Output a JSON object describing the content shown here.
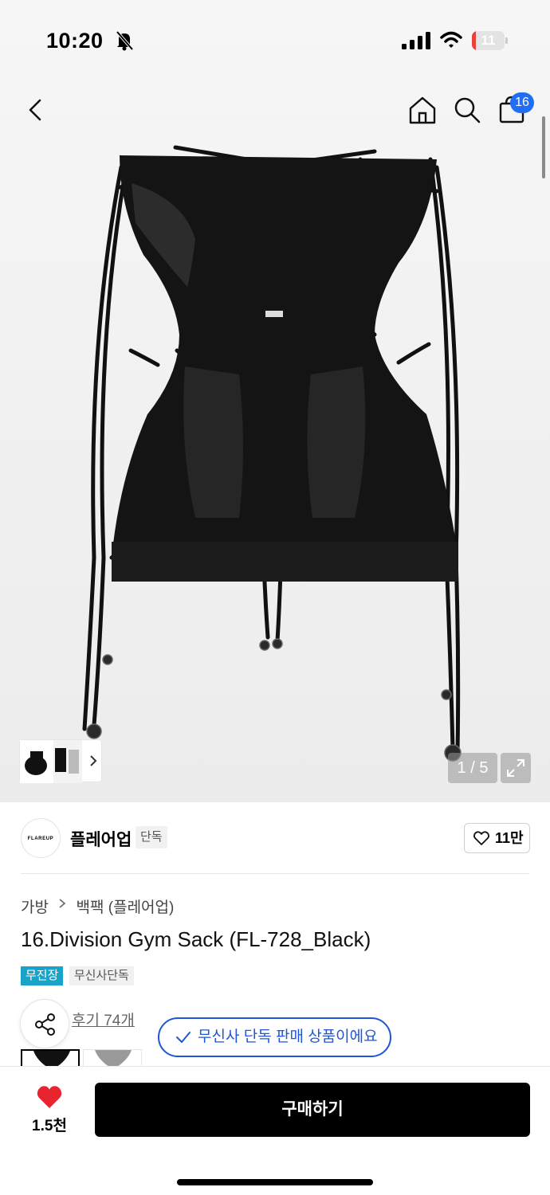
{
  "status_bar": {
    "time": "10:20",
    "battery": "11",
    "battery_level": 0.11,
    "icons": [
      "bell-slash-icon",
      "cellular-signal-icon",
      "wifi-icon",
      "battery-icon"
    ]
  },
  "header": {
    "icons": [
      "chevron-left-icon",
      "home-icon",
      "search-icon",
      "shopping-bag-icon"
    ],
    "cart_count": "16"
  },
  "gallery": {
    "counter": "1 / 5",
    "icons": [
      "chevron-right-icon",
      "expand-icon"
    ]
  },
  "brand": {
    "logo_text": "FLAREUP",
    "name": "플레어업",
    "tag": "단독",
    "likes": "11만"
  },
  "product": {
    "breadcrumb": [
      "가방",
      "백팩 (플레어업)"
    ],
    "title": "16.Division Gym Sack (FL-728_Black)",
    "tags": [
      "무진장",
      "무신사단독"
    ],
    "review_link": "후기 74개",
    "toast": "무신사 단독 판매 상품이에요"
  },
  "bottom_bar": {
    "heart_count": "1.5천",
    "buy_label": "구매하기"
  },
  "colors": {
    "accent_blue": "#1f55d8",
    "badge_blue": "#1f6ef5",
    "free_tag": "#1aa3c8",
    "heart_red": "#e8242f",
    "battery_red": "#e8413c"
  }
}
